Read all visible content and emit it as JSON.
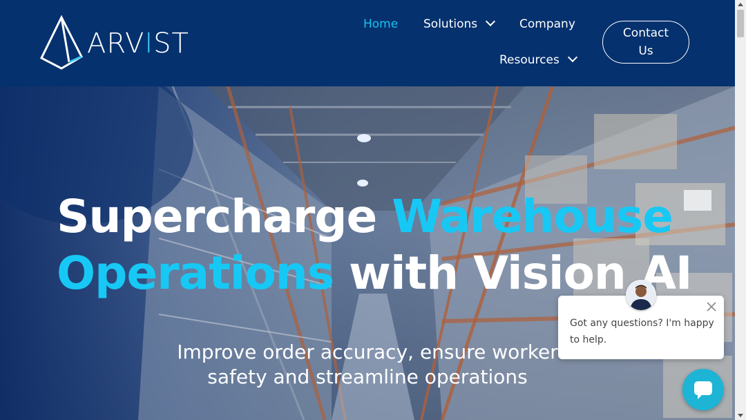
{
  "brand": {
    "name_prefix": "ARV",
    "name_accent": "I",
    "name_suffix": "ST",
    "accent_color": "#3ec6f3"
  },
  "nav": {
    "home": "Home",
    "solutions": "Solutions",
    "company": "Company",
    "resources": "Resources",
    "contact_line1": "Contact",
    "contact_line2": "Us"
  },
  "hero": {
    "title_line1_white": "Supercharge ",
    "title_line1_cyan": "Warehouse",
    "title_line2_cyan": "Operations",
    "title_line2_white": " with Vision AI",
    "subtitle_line1": "Improve order accuracy, ensure worker",
    "subtitle_line2": "safety and streamline operations"
  },
  "chat": {
    "message": "Got any questions? I'm happy to help."
  },
  "colors": {
    "header_bg": "#05316e",
    "accent": "#17c8f5",
    "chat_launcher": "#1db4d6"
  }
}
